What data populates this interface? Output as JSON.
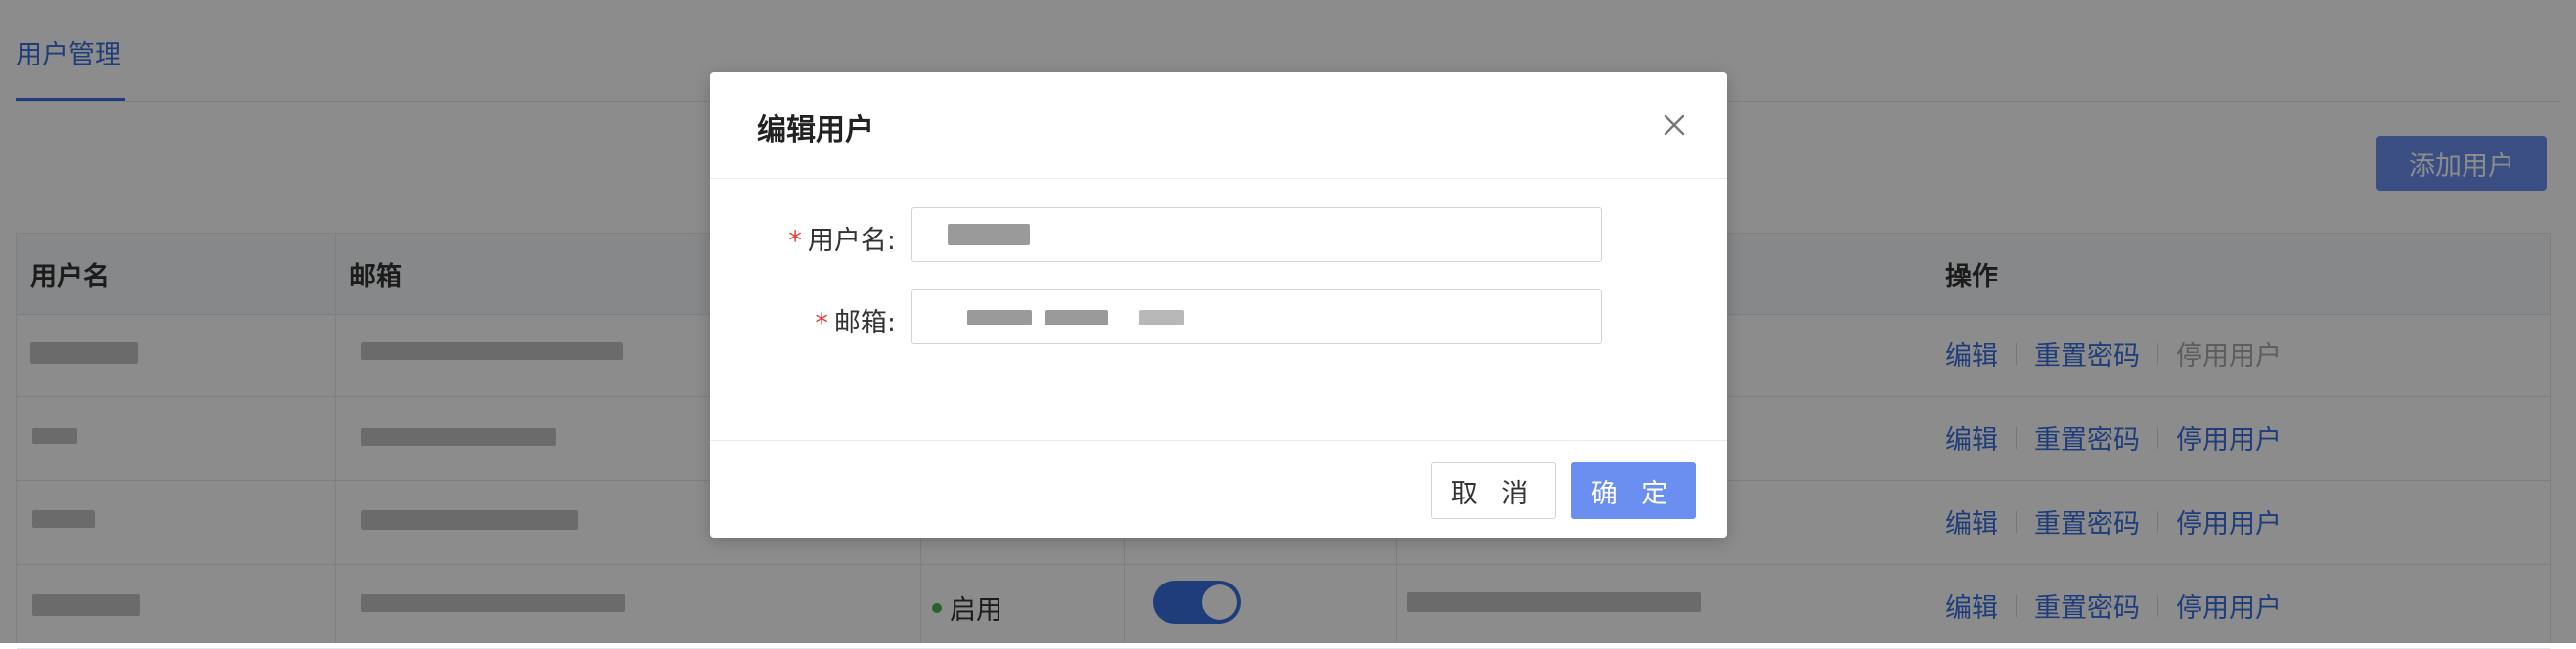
{
  "tabs": {
    "active_label": "用户管理"
  },
  "toolbar": {
    "add_user_label": "添加用户"
  },
  "table": {
    "headers": {
      "username": "用户名",
      "email": "邮箱",
      "actions": "操作"
    },
    "status_enabled_label": "启用",
    "actions": {
      "edit": "编辑",
      "reset_password": "重置密码",
      "disable_user": "停用用户"
    }
  },
  "dialog": {
    "title": "编辑用户",
    "username_label": "用户名",
    "email_label": "邮箱",
    "required_mark": "*",
    "label_colon": ":",
    "cancel_label": "取 消",
    "confirm_label": "确 定"
  },
  "colors": {
    "primary": "#3b6fe0",
    "primary_button": "#6b8ff0",
    "required": "#e53935",
    "status_enabled": "#4caf50"
  },
  "icons": {
    "close": "close-icon"
  }
}
